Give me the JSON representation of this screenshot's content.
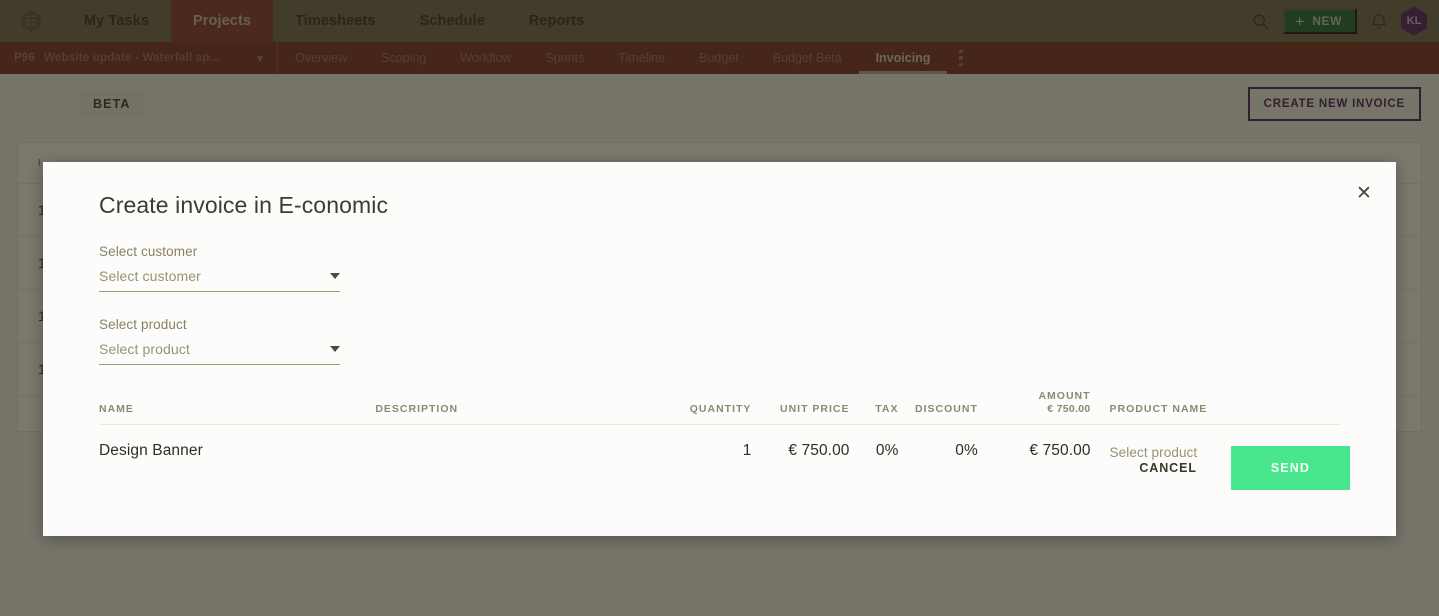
{
  "topnav": {
    "logo": "logo-hex-icon",
    "items": [
      {
        "label": "My Tasks",
        "active": false
      },
      {
        "label": "Projects",
        "active": true
      },
      {
        "label": "Timesheets",
        "active": false
      },
      {
        "label": "Schedule",
        "active": false
      },
      {
        "label": "Reports",
        "active": false
      }
    ],
    "search_icon": "search-icon",
    "new_button": {
      "label": "NEW",
      "plus": "+",
      "color": "#0a5c2e"
    },
    "bell_icon": "bell-icon",
    "avatar": {
      "initials": "KL",
      "color": "#4b0d63"
    }
  },
  "subnav": {
    "project_id": "P96",
    "project_name": "Website update - Waterfall ap...",
    "chevron": "⌄",
    "items": [
      {
        "label": "Overview",
        "active": false
      },
      {
        "label": "Scoping",
        "active": false
      },
      {
        "label": "Workflow",
        "active": false
      },
      {
        "label": "Sprints",
        "active": false
      },
      {
        "label": "Timeline",
        "active": false
      },
      {
        "label": "Budget",
        "active": false
      },
      {
        "label": "Budget Beta",
        "active": false
      },
      {
        "label": "Invoicing",
        "active": true
      }
    ],
    "kebab": "more-options-icon"
  },
  "page": {
    "beta_badge": "BETA",
    "create_invoice_label": "CREATE NEW INVOICE",
    "accent_purple": "#3b0b52",
    "background_table": {
      "columns": [
        "I"
      ],
      "rows": [
        [
          "1"
        ],
        [
          "1"
        ],
        [
          "1"
        ],
        [
          "1"
        ]
      ]
    }
  },
  "modal": {
    "title": "Create invoice in E-conomic",
    "close_icon": "✕",
    "customer_field": {
      "label": "Select customer",
      "value": "",
      "placeholder": "Select customer"
    },
    "product_field": {
      "label": "Select product",
      "value": "",
      "placeholder": "Select product"
    },
    "table": {
      "headers": {
        "name": "NAME",
        "description": "DESCRIPTION",
        "quantity": "QUANTITY",
        "unit_price": "UNIT PRICE",
        "tax": "TAX",
        "discount": "DISCOUNT",
        "amount": "AMOUNT",
        "amount_total": "€ 750.00",
        "product_name": "PRODUCT NAME"
      },
      "rows": [
        {
          "name": "Design Banner",
          "description": "",
          "quantity": "1",
          "unit_price": "€ 750.00",
          "tax": "0%",
          "discount": "0%",
          "amount": "€ 750.00",
          "product_name": "Select product"
        }
      ]
    },
    "cancel_label": "CANCEL",
    "send_label": "SEND",
    "send_color": "#4ae68e"
  }
}
